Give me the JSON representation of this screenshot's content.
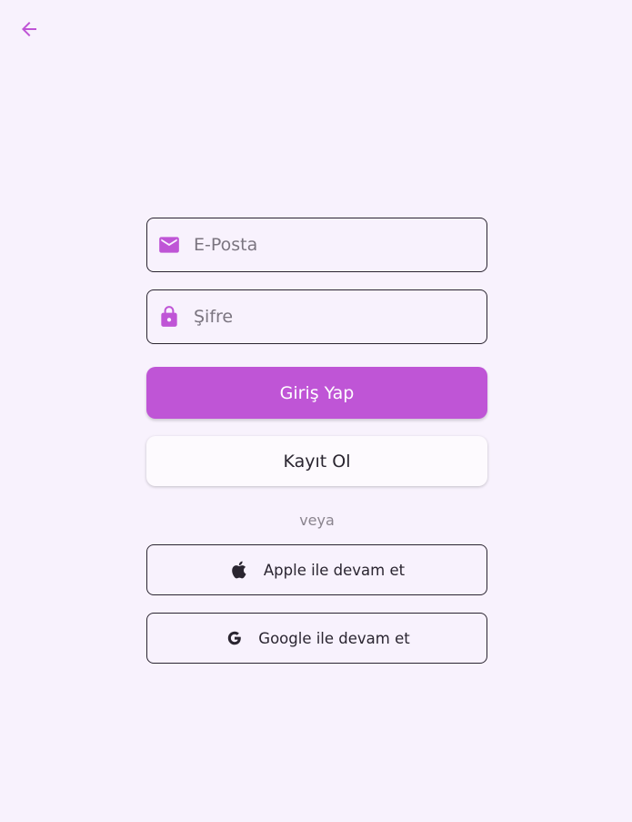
{
  "header": {
    "back_icon": "arrow-left-icon",
    "accent_color": "#bf55d6"
  },
  "form": {
    "email": {
      "placeholder": "E-Posta",
      "value": "",
      "icon": "mail-icon"
    },
    "password": {
      "placeholder": "Şifre",
      "value": "",
      "icon": "lock-icon"
    },
    "login_label": "Giriş Yap",
    "register_label": "Kayıt Ol",
    "divider_text": "veya",
    "apple_label": "Apple ile devam et",
    "apple_icon": "apple-icon",
    "google_label": "Google ile devam et",
    "google_icon": "google-icon"
  },
  "colors": {
    "background": "#f8f2fd",
    "primary": "#bf55d6",
    "text": "#2a2530"
  }
}
